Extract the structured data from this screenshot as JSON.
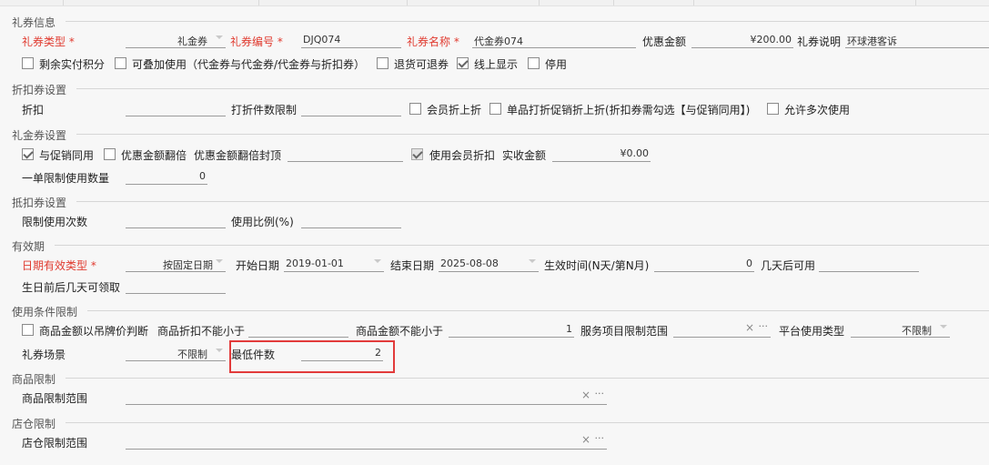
{
  "sections": {
    "coupon_info": "礼券信息",
    "discount": "折扣券设置",
    "gift": "礼金券设置",
    "deduction": "抵扣券设置",
    "validity": "有效期",
    "conditions": "使用条件限制",
    "product": "商品限制",
    "store": "店仓限制"
  },
  "coupon_info": {
    "type_label": "礼券类型",
    "type_value": "礼金券",
    "code_label": "礼券编号",
    "code_value": "DJQ074",
    "name_label": "礼券名称",
    "name_value": "代金券074",
    "amount_label": "优惠金额",
    "amount_value": "¥200.00",
    "desc_label": "礼券说明",
    "desc_value": "环球港客诉",
    "checks": [
      {
        "label": "剩余实付积分",
        "checked": false
      },
      {
        "label": "可叠加使用（代金券与代金券/代金券与折扣券）",
        "checked": false
      },
      {
        "label": "退货可退券",
        "checked": false
      },
      {
        "label": "线上显示",
        "checked": true
      },
      {
        "label": "停用",
        "checked": false
      }
    ]
  },
  "discount": {
    "discount_label": "折扣",
    "discount_value": "",
    "items_label": "打折件数限制",
    "items_value": "",
    "member_label": "会员折上折",
    "single_label": "单品打折促销折上折(折扣券需勾选【与促销同用】)",
    "multi_label": "允许多次使用"
  },
  "gift": {
    "promo_label": "与促销同用",
    "double_label": "优惠金额翻倍",
    "cap_label": "优惠金额翻倍封顶",
    "cap_value": "",
    "member_label": "使用会员折扣",
    "received_label": "实收金额",
    "received_value": "¥0.00",
    "limit_label": "一单限制使用数量",
    "limit_value": "0"
  },
  "deduction": {
    "times_label": "限制使用次数",
    "times_value": "",
    "ratio_label": "使用比例(%)",
    "ratio_value": ""
  },
  "validity": {
    "type_label": "日期有效类型",
    "type_value": "按固定日期",
    "start_label": "开始日期",
    "start_value": "2019-01-01",
    "end_label": "结束日期",
    "end_value": "2025-08-08",
    "effect_label": "生效时间(N天/第N月)",
    "effect_value": "0",
    "after_label": "几天后可用",
    "after_value": "",
    "birthday_label": "生日前后几天可领取",
    "birthday_value": ""
  },
  "conditions": {
    "tag_price_label": "商品金额以吊牌价判断",
    "min_discount_label": "商品折扣不能小于",
    "min_discount_value": "",
    "min_amount_label": "商品金额不能小于",
    "min_amount_value": "1",
    "service_label": "服务项目限制范围",
    "platform_label": "平台使用类型",
    "platform_value": "不限制",
    "scene_label": "礼券场景",
    "scene_value": "不限制",
    "min_qty_label": "最低件数",
    "min_qty_value": "2"
  },
  "product": {
    "range_label": "商品限制范围"
  },
  "store": {
    "range_label": "店仓限制范围"
  },
  "icons": {
    "clear": "×",
    "more": "···"
  }
}
